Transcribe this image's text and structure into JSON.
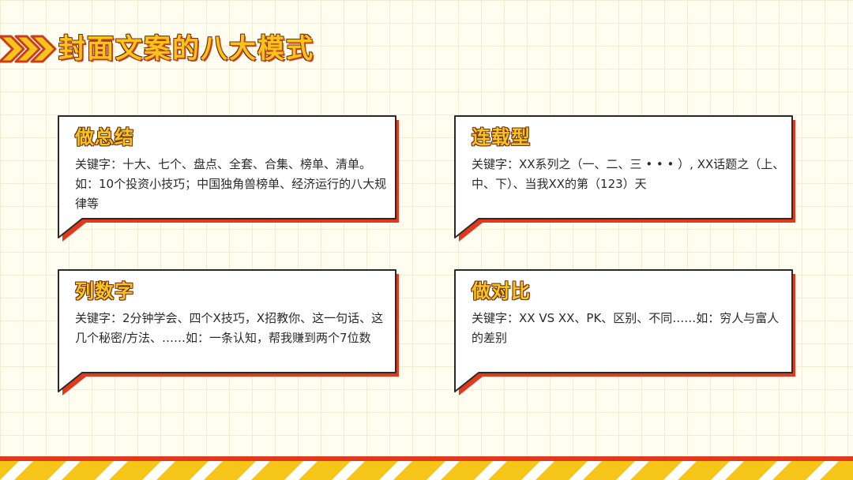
{
  "header": {
    "title": "封面文案的八大模式",
    "icon": "chevron-right-icon"
  },
  "colors": {
    "accent_yellow": "#f6c51a",
    "accent_red": "#e2381c",
    "outline_dark": "#3a2a1a"
  },
  "cards": [
    {
      "title": "做总结",
      "text": "关键字：十大、七个、盘点、全套、合集、榜单、清单。如：10个投资小技巧；中国独角兽榜单、经济运行的八大规律等"
    },
    {
      "title": "连载型",
      "text": "关键字：XX系列之（一、二、三 • • • ）, XX话题之（上、中、下）、当我XX的第（123）天"
    },
    {
      "title": "列数字",
      "text": "关键字：2分钟学会、四个X技巧，X招教你、这一句话、这几个秘密/方法、……如：一条认知，帮我赚到两个7位数"
    },
    {
      "title": "做对比",
      "text": "关键字：XX VS XX、PK、区别、不同……如：穷人与富人的差别"
    }
  ]
}
